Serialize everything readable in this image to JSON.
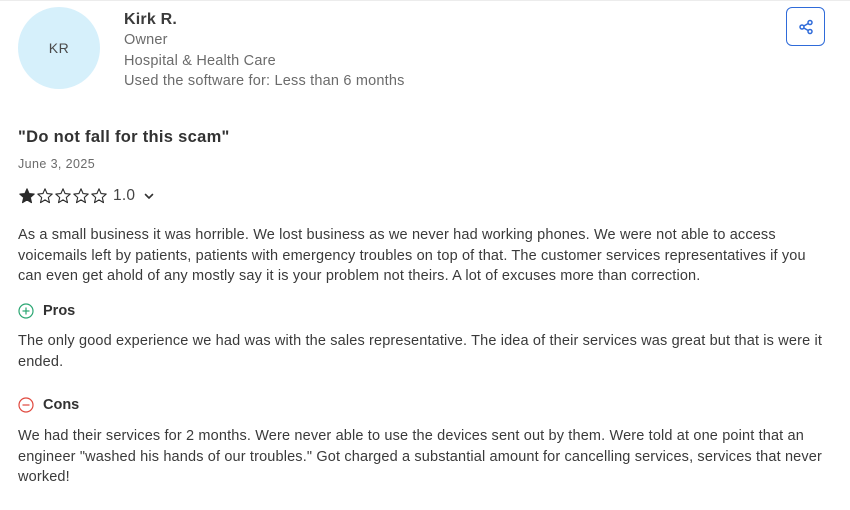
{
  "reviewer": {
    "initials": "KR",
    "name": "Kirk R.",
    "role": "Owner",
    "industry": "Hospital & Health Care",
    "usage": "Used the software for: Less than 6 months"
  },
  "review": {
    "title": "\"Do not fall for this scam\"",
    "date": "June 3, 2025",
    "rating": 1,
    "rating_max": 5,
    "rating_label": "1.0",
    "summary": "As a small business it was horrible. We lost business as we never had working phones. We were not able to access voicemails left by patients, patients with emergency troubles on top of that. The customer services representatives if you can even get ahold of any mostly say it is your problem not theirs. A lot of excuses more than correction.",
    "pros_label": "Pros",
    "pros_text": "The only good experience we had was with the sales representative. The idea of their services was great but that is were it ended.",
    "cons_label": "Cons",
    "cons_text": "We had their services for 2 months. Were never able to use the devices sent out by them. Were told at one point that an engineer \"washed his hands of our troubles.\" Got charged a substantial amount for cancelling services, services that never worked!"
  },
  "icons": {
    "share": "share-icon",
    "star_filled": "star-filled-icon",
    "star_empty": "star-outline-icon",
    "chevron": "chevron-down-icon",
    "pros": "plus-circle-icon",
    "cons": "minus-circle-icon"
  },
  "colors": {
    "avatar_bg": "#d6f0fb",
    "share_border": "#2f6bd9",
    "pros_green": "#2aa672",
    "cons_red": "#e0483e",
    "star": "#2b2b2b"
  }
}
